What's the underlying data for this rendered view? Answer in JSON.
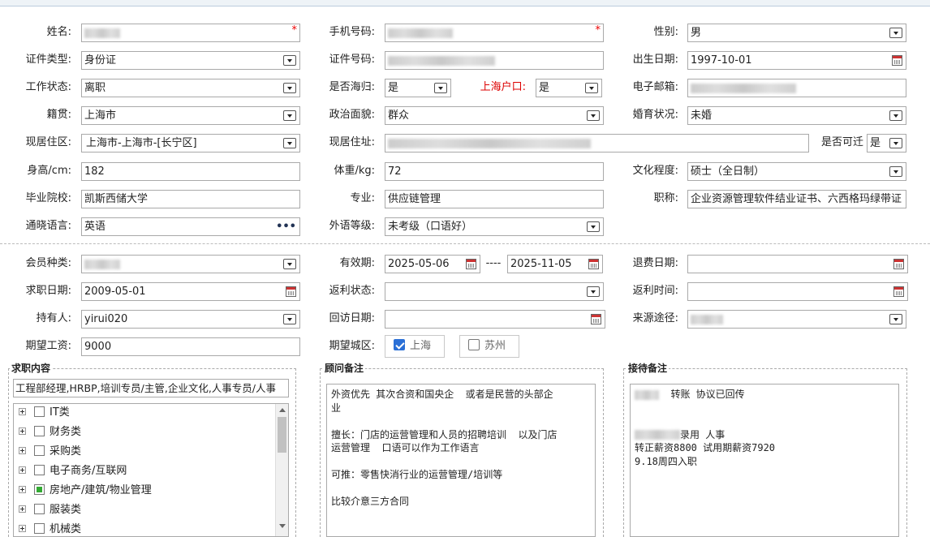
{
  "personal": {
    "name": {
      "label": "姓名:",
      "value": "",
      "required": "*"
    },
    "phone": {
      "label": "手机号码:",
      "value": "",
      "required": "*"
    },
    "gender": {
      "label": "性别:",
      "value": "男"
    },
    "id_type": {
      "label": "证件类型:",
      "value": "身份证"
    },
    "id_number": {
      "label": "证件号码:",
      "value": ""
    },
    "birth_date": {
      "label": "出生日期:",
      "value": "1997-10-01"
    },
    "work_status": {
      "label": "工作状态:",
      "value": "离职"
    },
    "returnee": {
      "label": "是否海归:",
      "value": "是"
    },
    "shanghai_hukou": {
      "label": "上海户口:",
      "value": "是"
    },
    "email": {
      "label": "电子邮箱:",
      "value": ""
    },
    "native_place": {
      "label": "籍贯:",
      "value": "上海市"
    },
    "political": {
      "label": "政治面貌:",
      "value": "群众"
    },
    "marital": {
      "label": "婚育状况:",
      "value": "未婚"
    },
    "residence_area": {
      "label": "现居住区:",
      "value": "上海市-上海市-[长宁区]"
    },
    "residence_address": {
      "label": "现居住址:",
      "value": ""
    },
    "relocate": {
      "label": "是否可迁",
      "value": "是"
    },
    "height": {
      "label": "身高/cm:",
      "value": "182"
    },
    "weight": {
      "label": "体重/kg:",
      "value": "72"
    },
    "education": {
      "label": "文化程度:",
      "value": "硕士（全日制）"
    },
    "school": {
      "label": "毕业院校:",
      "value": "凯斯西储大学"
    },
    "major": {
      "label": "专业:",
      "value": "供应链管理"
    },
    "title": {
      "label": "职称:",
      "value": "企业资源管理软件结业证书、六西格玛绿带证"
    },
    "language": {
      "label": "通晓语言:",
      "value": "英语"
    },
    "foreign_level": {
      "label": "外语等级:",
      "value": "未考级（口语好）"
    }
  },
  "member": {
    "member_type": {
      "label": "会员种类:",
      "value": ""
    },
    "valid_period": {
      "label": "有效期:",
      "from": "2025-05-06",
      "sep": "----",
      "to": "2025-11-05"
    },
    "refund_date": {
      "label": "退费日期:",
      "value": ""
    },
    "job_date": {
      "label": "求职日期:",
      "value": "2009-05-01"
    },
    "rebate_status": {
      "label": "返利状态:",
      "value": ""
    },
    "rebate_time": {
      "label": "返利时间:",
      "value": ""
    },
    "holder": {
      "label": "持有人:",
      "value": "yirui020"
    },
    "visit_date": {
      "label": "回访日期:",
      "value": ""
    },
    "source": {
      "label": "来源途径:",
      "value": ""
    },
    "expected_salary": {
      "label": "期望工资:",
      "value": "9000"
    },
    "expected_city": {
      "label": "期望城区:",
      "options": [
        {
          "label": "上海",
          "checked": true
        },
        {
          "label": "苏州",
          "checked": false
        }
      ]
    }
  },
  "job_content": {
    "title": "求职内容",
    "selected": "工程部经理,HRBP,培训专员/主管,企业文化,人事专员/人事",
    "tree": [
      {
        "label": "IT类",
        "state": "unchecked"
      },
      {
        "label": "财务类",
        "state": "unchecked"
      },
      {
        "label": "采购类",
        "state": "unchecked"
      },
      {
        "label": "电子商务/互联网",
        "state": "unchecked"
      },
      {
        "label": "房地产/建筑/物业管理",
        "state": "partial"
      },
      {
        "label": "服装类",
        "state": "unchecked"
      },
      {
        "label": "机械类",
        "state": "unchecked"
      }
    ]
  },
  "advisor_notes": {
    "title": "顾问备注",
    "lines": [
      "外资优先 其次合资和国央企  或者是民营的头部企",
      "业",
      "",
      "擅长：门店的运营管理和人员的招聘培训  以及门店",
      "运营管理  口语可以作为工作语言",
      "",
      "可推：零售快消行业的运营管理/培训等",
      "",
      "比较介意三方合同"
    ]
  },
  "reception_notes": {
    "title": "接待备注",
    "line1": "转账 协议已回传",
    "line2": "录用 人事",
    "line3": "转正薪资8800 试用期薪资7920",
    "line4": "9.18周四入职"
  },
  "icons": {
    "dropdown": "chevron-down-icon",
    "calendar": "calendar-icon",
    "more": "more-dots-icon"
  }
}
